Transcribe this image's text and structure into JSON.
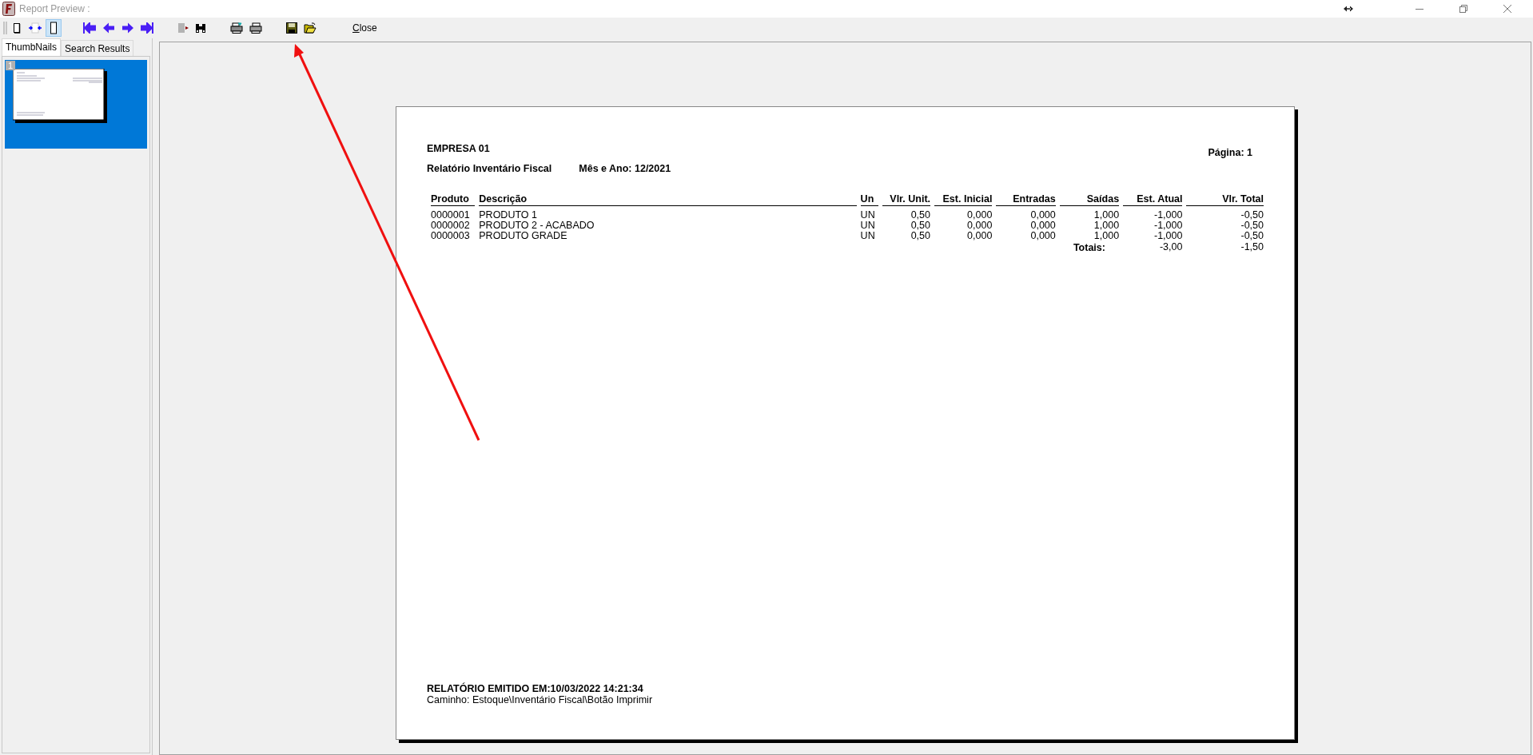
{
  "window": {
    "title": "Report Preview :"
  },
  "toolbar": {
    "view_buttons": [
      {
        "selected": false
      },
      {
        "selected": false
      },
      {
        "selected": true
      }
    ],
    "close_label": "Close"
  },
  "tabs": [
    {
      "label": "ThumbNails",
      "selected": true
    },
    {
      "label": "Search Results",
      "selected": false
    }
  ],
  "thumbnails": [
    {
      "number": "1",
      "selected": true
    }
  ],
  "report": {
    "company": "EMPRESA 01",
    "page_label": "Página: 1",
    "title": "Relatório Inventário Fiscal",
    "period": "Mês e Ano: 12/2021",
    "columns": [
      {
        "label": "Produto",
        "kind": "text"
      },
      {
        "label": "Descrição",
        "kind": "text"
      },
      {
        "label": "Un",
        "kind": "text"
      },
      {
        "label": "Vlr. Unit.",
        "kind": "number"
      },
      {
        "label": "Est. Inicial",
        "kind": "number"
      },
      {
        "label": "Entradas",
        "kind": "number"
      },
      {
        "label": "Saídas",
        "kind": "number"
      },
      {
        "label": "Est. Atual",
        "kind": "number"
      },
      {
        "label": "Vlr. Total",
        "kind": "number"
      }
    ],
    "rows": [
      [
        "0000001",
        "PRODUTO 1",
        "UN",
        "0,50",
        "0,000",
        "0,000",
        "1,000",
        "-1,000",
        "-0,50"
      ],
      [
        "0000002",
        "PRODUTO 2 - ACABADO",
        "UN",
        "0,50",
        "0,000",
        "0,000",
        "1,000",
        "-1,000",
        "-0,50"
      ],
      [
        "0000003",
        "PRODUTO GRADE",
        "UN",
        "0,50",
        "0,000",
        "0,000",
        "1,000",
        "-1,000",
        "-0,50"
      ]
    ],
    "totals": {
      "label": "Totais:",
      "values": [
        "-3,00",
        "-1,50"
      ]
    },
    "footer": {
      "emitted": "RELATÓRIO EMITIDO EM:10/03/2022 14:21:34",
      "path": "Caminho: Estoque\\Inventário Fiscal\\Botão Imprimir"
    }
  }
}
